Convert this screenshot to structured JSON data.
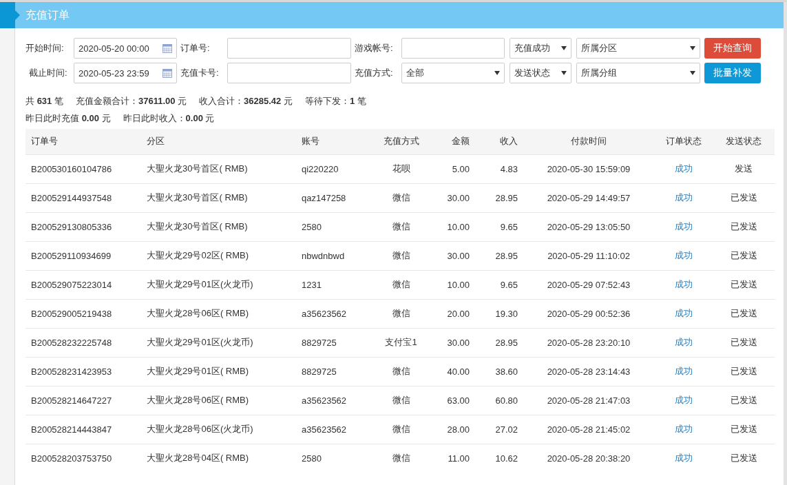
{
  "header": {
    "title": "充值订单"
  },
  "filters": [
    {
      "kind": "date",
      "label": "开始时间:",
      "value": "2020-05-20 00:00"
    },
    {
      "kind": "text",
      "label": "订单号:"
    },
    {
      "kind": "text",
      "label": "游戏帐号:"
    },
    {
      "kind": "select",
      "value": "充值成功"
    },
    {
      "kind": "select",
      "value": "所属分区"
    },
    {
      "kind": "button",
      "color": "#dd4b39",
      "value": "开始查询"
    },
    {
      "kind": "date",
      "label": "截止时间:",
      "value": "2020-05-23 23:59"
    },
    {
      "kind": "text",
      "label": "充值卡号:"
    },
    {
      "kind": "select",
      "label": "充值方式:",
      "value": "全部"
    },
    {
      "kind": "select",
      "value": "发送状态"
    },
    {
      "kind": "select",
      "value": "所属分组"
    },
    {
      "kind": "button",
      "color": "#0e98d6",
      "value": "批量补发"
    }
  ],
  "summary": [
    "共 **631** 笔",
    "充值金额合计：**37611.00** 元",
    "收入合计：**36285.42** 元",
    "等待下发：**1** 笔"
  ],
  "summary2": [
    "昨日此时充值 **0.00** 元",
    "昨日此时收入：**0.00** 元"
  ],
  "table": {
    "columns": [
      "订单号",
      "分区",
      "账号",
      "充值方式",
      "金额",
      "收入",
      "付款时间",
      "订单状态",
      "发送状态"
    ],
    "rows": [
      [
        "B200530160104786",
        "大聖火龙30号首区( RMB)",
        "qi220220",
        "花呗",
        "5.00",
        "4.83",
        "2020-05-30 15:59:09",
        "成功",
        "发送"
      ],
      [
        "B200529144937548",
        "大聖火龙30号首区( RMB)",
        "qaz147258",
        "微信",
        "30.00",
        "28.95",
        "2020-05-29 14:49:57",
        "成功",
        "已发送"
      ],
      [
        "B200529130805336",
        "大聖火龙30号首区( RMB)",
        "2580",
        "微信",
        "10.00",
        "9.65",
        "2020-05-29 13:05:50",
        "成功",
        "已发送"
      ],
      [
        "B200529110934699",
        "大聖火龙29号02区( RMB)",
        "nbwdnbwd",
        "微信",
        "30.00",
        "28.95",
        "2020-05-29 11:10:02",
        "成功",
        "已发送"
      ],
      [
        "B200529075223014",
        "大聖火龙29号01区(火龙币)",
        "1231",
        "微信",
        "10.00",
        "9.65",
        "2020-05-29 07:52:43",
        "成功",
        "已发送"
      ],
      [
        "B200529005219438",
        "大聖火龙28号06区( RMB)",
        "a35623562",
        "微信",
        "20.00",
        "19.30",
        "2020-05-29 00:52:36",
        "成功",
        "已发送"
      ],
      [
        "B200528232225748",
        "大聖火龙29号01区(火龙币)",
        "8829725",
        "支付宝1",
        "30.00",
        "28.95",
        "2020-05-28 23:20:10",
        "成功",
        "已发送"
      ],
      [
        "B200528231423953",
        "大聖火龙29号01区( RMB)",
        "8829725",
        "微信",
        "40.00",
        "38.60",
        "2020-05-28 23:14:43",
        "成功",
        "已发送"
      ],
      [
        "B200528214647227",
        "大聖火龙28号06区( RMB)",
        "a35623562",
        "微信",
        "63.00",
        "60.80",
        "2020-05-28 21:47:03",
        "成功",
        "已发送"
      ],
      [
        "B200528214443847",
        "大聖火龙28号06区(火龙币)",
        "a35623562",
        "微信",
        "28.00",
        "27.02",
        "2020-05-28 21:45:02",
        "成功",
        "已发送"
      ],
      [
        "B200528203753750",
        "大聖火龙28号04区( RMB)",
        "2580",
        "微信",
        "11.00",
        "10.62",
        "2020-05-28 20:38:20",
        "成功",
        "已发送"
      ]
    ]
  }
}
